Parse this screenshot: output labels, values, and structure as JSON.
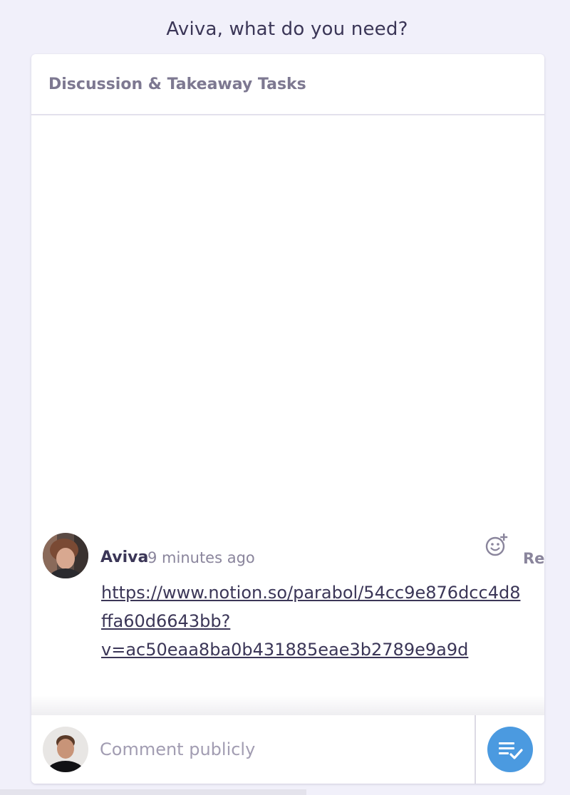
{
  "page": {
    "prompt": "Aviva, what do you need?"
  },
  "card": {
    "title": "Discussion & Takeaway Tasks"
  },
  "comment": {
    "author": "Aviva",
    "time": "9 minutes ago",
    "reply_label": "Reply",
    "link_lines": [
      "https://www.notion.so/parabol/54cc9e876dcc4d8",
      "ffa60d6643bb?",
      "v=ac50eaa8ba0b431885eae3b2789e9a9d"
    ],
    "icons": {
      "avatar": "avatar-photo",
      "reaction": "add-reaction-icon"
    }
  },
  "composer": {
    "placeholder": "Comment publicly",
    "icons": {
      "avatar": "avatar-photo",
      "task": "add-task-icon"
    }
  },
  "colors": {
    "background": "#f1f0fa",
    "card": "#ffffff",
    "text": "#3b3657",
    "muted": "#8a859c",
    "accent": "#4b9ae0"
  }
}
